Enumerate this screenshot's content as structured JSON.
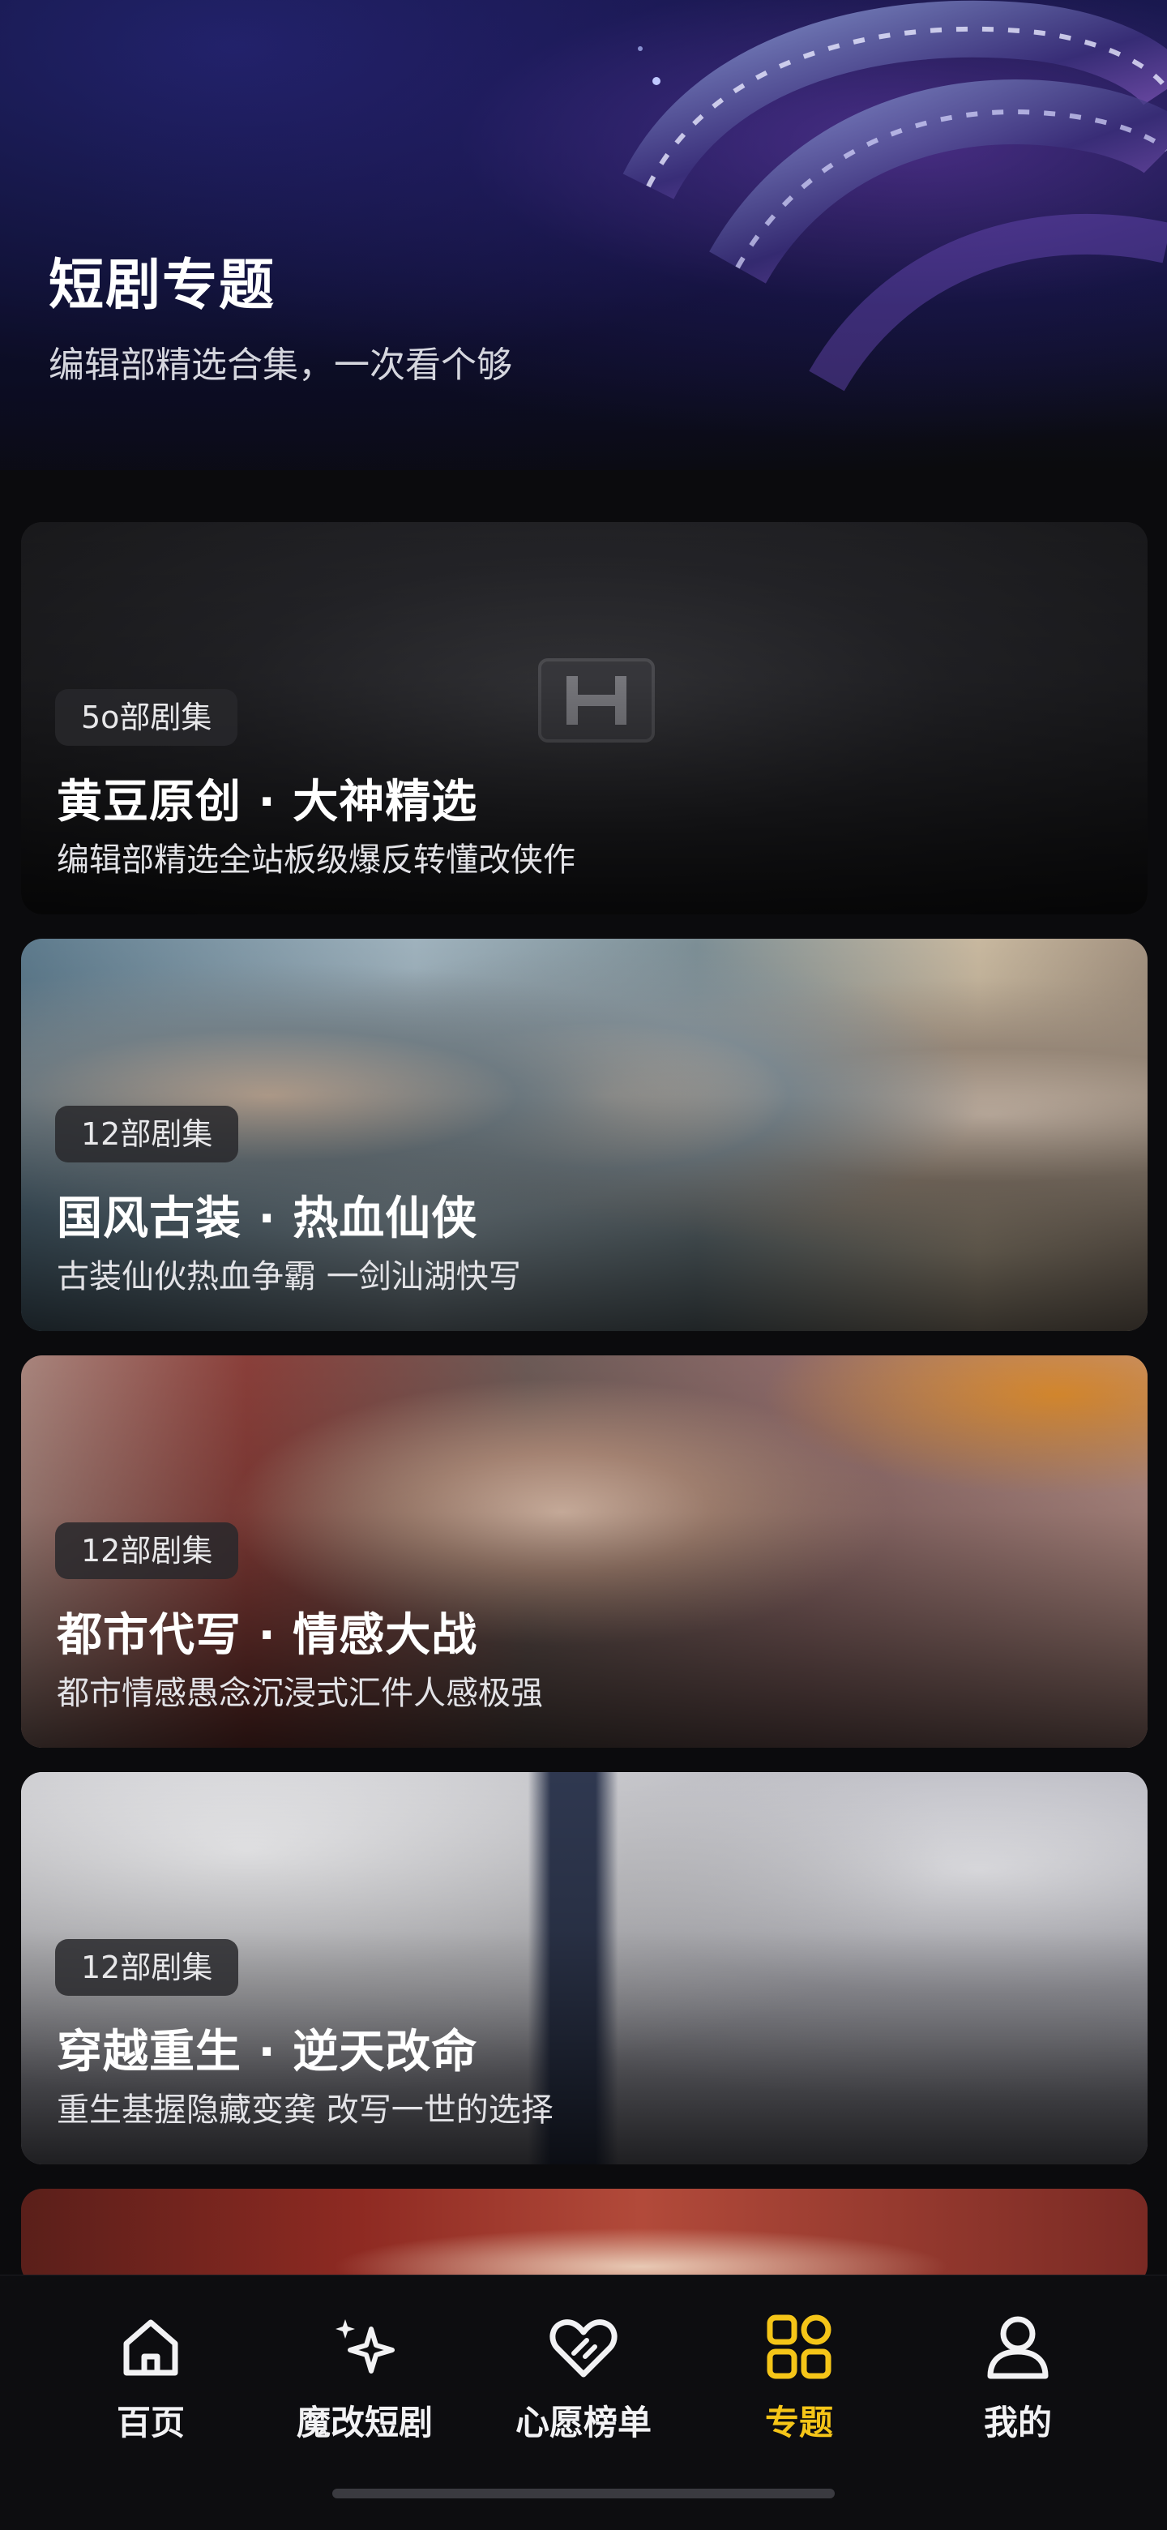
{
  "colors": {
    "accent": "#f5c518",
    "background": "#0b0b0d",
    "text": "#ffffff"
  },
  "header": {
    "title": "短剧专题",
    "subtitle": "编辑部精选合集，一次看个够"
  },
  "collections": [
    {
      "badge": "5o部剧集",
      "title": "黄豆原创 · 大神精选",
      "description": "编辑部精选全站板级爆反转懂改侠作"
    },
    {
      "badge": "12部剧集",
      "title": "国风古装 · 热血仙侠",
      "description": "古装仙伙热血争霸 一剑汕湖快写"
    },
    {
      "badge": "12部剧集",
      "title": "都市代写 · 情感大战",
      "description": "都市情感愚念沉浸式汇件人感极强"
    },
    {
      "badge": "12部剧集",
      "title": "穿越重生 · 逆天改命",
      "description": "重生基握隐藏变龚 改写一世的选择"
    }
  ],
  "bottom_nav": {
    "items": [
      {
        "label": "百页",
        "icon": "home-icon",
        "active": false
      },
      {
        "label": "魔改短剧",
        "icon": "sparkle-icon",
        "active": false
      },
      {
        "label": "心愿榜单",
        "icon": "heart-icon",
        "active": false
      },
      {
        "label": "专题",
        "icon": "grid-icon",
        "active": true
      },
      {
        "label": "我的",
        "icon": "user-icon",
        "active": false
      }
    ]
  }
}
